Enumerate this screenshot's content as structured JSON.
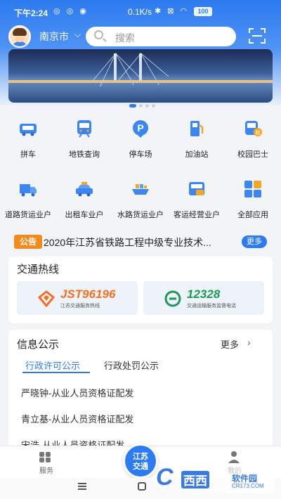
{
  "status_bar": {
    "time": "下午2:24",
    "speed": "0.1K/s",
    "battery": "100"
  },
  "header": {
    "city": "南京市",
    "search_placeholder": "搜索"
  },
  "banner": {
    "slide_count": 4,
    "active_slide": 0
  },
  "services": [
    {
      "label": "拼车",
      "icon": "car-icon"
    },
    {
      "label": "地铁查询",
      "icon": "metro-icon"
    },
    {
      "label": "停车场",
      "icon": "parking-icon"
    },
    {
      "label": "加油站",
      "icon": "gas-station-icon"
    },
    {
      "label": "校园巴士",
      "icon": "school-bus-icon"
    },
    {
      "label": "道路货运业户",
      "icon": "truck-icon"
    },
    {
      "label": "出租车业户",
      "icon": "taxi-icon"
    },
    {
      "label": "水路货运业户",
      "icon": "cargo-ship-icon"
    },
    {
      "label": "客运经营业户",
      "icon": "passenger-transport-icon"
    },
    {
      "label": "全部应用",
      "icon": "all-apps-icon"
    }
  ],
  "notice": {
    "tag": "公告",
    "text": "2020年江苏省铁路工程中级专业技术...",
    "more": "更多"
  },
  "traffic": {
    "title": "交通热线",
    "hotlines": [
      {
        "number": "JST96196",
        "subtitle": "江苏交通服务热线",
        "color": "#f37021"
      },
      {
        "number": "12328",
        "subtitle": "交通运输服务监督电话",
        "color": "#1a9a52"
      }
    ]
  },
  "info": {
    "title": "信息公示",
    "more": "更多",
    "tabs": [
      "行政许可公示",
      "行政处罚公示"
    ],
    "active_tab": 0,
    "items": [
      "严晓钟-从业人员资格证配发",
      "青立基-从业人员资格证配发",
      "宋浩-从业人员资格证配发"
    ]
  },
  "tabbar": {
    "left": "服务",
    "center": "江苏\n交通",
    "right": "我的"
  },
  "watermark": {
    "brand": "西西",
    "text": "软件园",
    "site": "CR173.COM"
  },
  "colors": {
    "primary": "#2d7bf0",
    "notice": "#f38a1c"
  }
}
